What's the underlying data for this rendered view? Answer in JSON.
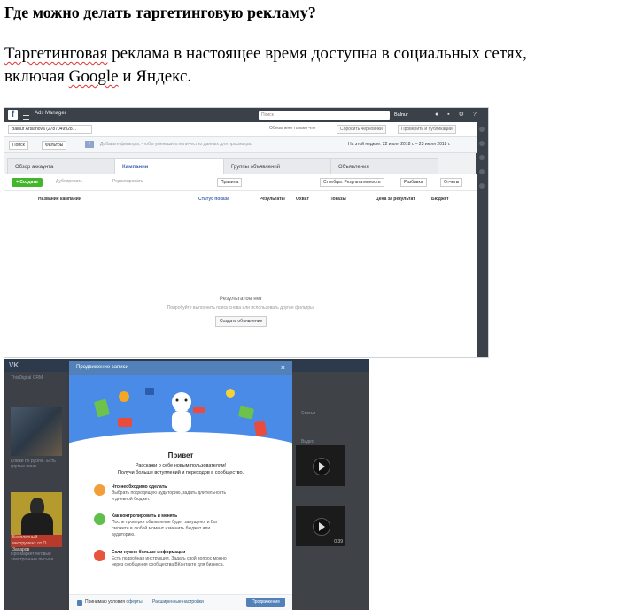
{
  "heading": "Где можно делать таргетинговую рекламу?",
  "paragraph": {
    "part1": "Таргетинговая",
    "part2": " реклама в настоящее время доступна в социальных сетях,",
    "part3": "включая ",
    "part4": "Google",
    "part5": " и Яндекс."
  },
  "ads_manager": {
    "app_name": "Ads Manager",
    "search_placeholder": "Поиск",
    "user": "Balnur",
    "account": "Balnur Arslanova (2787049928...",
    "updated": "Обновлено только что",
    "reset": "Сбросить черновики",
    "review": "Проверить и публикации",
    "filters": [
      "Поиск",
      "Фильтры"
    ],
    "filter_hint": "Добавьте фильтры, чтобы уменьшить количество данных для просмотра.",
    "date_range": "На этой неделе: 22 июля 2018 г. – 23 июля 2018 г.",
    "tabs": [
      "Обзор аккаунта",
      "Кампании",
      "Группы объявлений",
      "Объявления"
    ],
    "toolbar": {
      "create": "+ Создать",
      "duplicate": "Дублировать",
      "edit": "Редактировать",
      "rules": "Правила",
      "columns": "Столбцы: Результативность",
      "breakdown": "Разбивка",
      "reports": "Отчеты"
    },
    "columns": [
      "Название кампании",
      "Статус показа",
      "Результаты",
      "Охват",
      "Показы",
      "Цена за результат",
      "Бюджет"
    ],
    "empty_title": "Результатов нет",
    "empty_sub": "Попробуйте выполнить поиск снова или использовать другие фильтры.",
    "empty_button": "Создать объявление"
  },
  "vk": {
    "logo": "VK",
    "left_top": "ThisDigital CRM",
    "left_caption1": "Клюки по рублю. Есть крутые пины",
    "left_red": "Бесплатный инструмент от О. Захаров",
    "left_caption2": "Про маркетинговые электронные письма",
    "right_label1": "Статьи",
    "right_label2": "Видео",
    "right_time": "0:39",
    "modal": {
      "title": "Продвижение записи",
      "close": "×",
      "hello": "Привет",
      "sub1": "Расскажи о себе новым пользователям!",
      "sub2": "Получи больше вступлений и переходов в сообщество.",
      "items": [
        {
          "title": "Что необходимо сделать",
          "desc": "Выбрать подходящую аудиторию, задать длительность и дневной бюджет.",
          "color": "#f29e3a"
        },
        {
          "title": "Как контролировать и менять",
          "desc": "После проверки объявление будет запущено, и Вы сможете в любой момент изменить бюджет или аудиторию.",
          "color": "#5ebf4a"
        },
        {
          "title": "Если нужно больше информации",
          "desc": "Есть подробная инструкция. Задать свой вопрос можно через сообщения сообщества ВКонтакте для бизнеса.",
          "color": "#e6553c"
        }
      ],
      "footer_accept": "Принимаю условия",
      "footer_link": "оферты",
      "footer_settings": "Расширенные настройки",
      "button": "Продвижение"
    }
  }
}
